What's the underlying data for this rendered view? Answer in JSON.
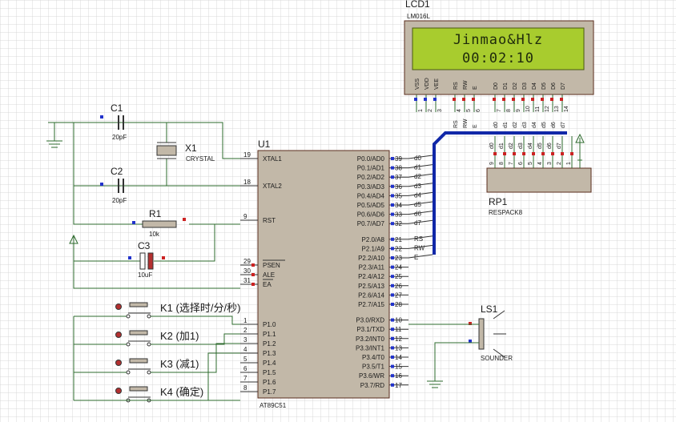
{
  "lcd": {
    "ref": "LCD1",
    "model": "LM016L",
    "line1": "Jinmao&Hlz",
    "line2": "00:02:10",
    "pins_power": [
      "VSS",
      "VDD",
      "VEE"
    ],
    "pins_ctrl": [
      "RS",
      "RW",
      "E"
    ],
    "pins_data": [
      "D0",
      "D1",
      "D2",
      "D3",
      "D4",
      "D5",
      "D6",
      "D7"
    ],
    "pin_numbers": [
      "1",
      "2",
      "3",
      "4",
      "5",
      "6",
      "7",
      "8",
      "9",
      "10",
      "11",
      "12",
      "13",
      "14"
    ],
    "bus_labels": [
      "RS",
      "RW",
      "E",
      "d0",
      "d1",
      "d2",
      "d3",
      "d4",
      "d5",
      "d6",
      "d7"
    ]
  },
  "mcu": {
    "ref": "U1",
    "part": "AT89C51",
    "left_pins": [
      {
        "num": "19",
        "name": "XTAL1"
      },
      {
        "num": "18",
        "name": "XTAL2"
      },
      {
        "num": "9",
        "name": "RST"
      },
      {
        "num": "29",
        "name": "PSEN"
      },
      {
        "num": "30",
        "name": "ALE"
      },
      {
        "num": "31",
        "name": "EA"
      },
      {
        "num": "1",
        "name": "P1.0"
      },
      {
        "num": "2",
        "name": "P1.1"
      },
      {
        "num": "3",
        "name": "P1.2"
      },
      {
        "num": "4",
        "name": "P1.3"
      },
      {
        "num": "5",
        "name": "P1.4"
      },
      {
        "num": "6",
        "name": "P1.5"
      },
      {
        "num": "7",
        "name": "P1.6"
      },
      {
        "num": "8",
        "name": "P1.7"
      }
    ],
    "right_pins": [
      {
        "num": "39",
        "name": "P0.0/AD0",
        "net": "d0"
      },
      {
        "num": "38",
        "name": "P0.1/AD1",
        "net": "d1"
      },
      {
        "num": "37",
        "name": "P0.2/AD2",
        "net": "d2"
      },
      {
        "num": "36",
        "name": "P0.3/AD3",
        "net": "d3"
      },
      {
        "num": "35",
        "name": "P0.4/AD4",
        "net": "d4"
      },
      {
        "num": "34",
        "name": "P0.5/AD5",
        "net": "d5"
      },
      {
        "num": "33",
        "name": "P0.6/AD6",
        "net": "d6"
      },
      {
        "num": "32",
        "name": "P0.7/AD7",
        "net": "d7"
      },
      {
        "num": "21",
        "name": "P2.0/A8",
        "net": "RS"
      },
      {
        "num": "22",
        "name": "P2.1/A9",
        "net": "RW"
      },
      {
        "num": "23",
        "name": "P2.2/A10",
        "net": "E"
      },
      {
        "num": "24",
        "name": "P2.3/A11",
        "net": ""
      },
      {
        "num": "25",
        "name": "P2.4/A12",
        "net": ""
      },
      {
        "num": "26",
        "name": "P2.5/A13",
        "net": ""
      },
      {
        "num": "27",
        "name": "P2.6/A14",
        "net": ""
      },
      {
        "num": "28",
        "name": "P2.7/A15",
        "net": ""
      },
      {
        "num": "10",
        "name": "P3.0/RXD",
        "net": ""
      },
      {
        "num": "11",
        "name": "P3.1/TXD",
        "net": ""
      },
      {
        "num": "12",
        "name": "P3.2/INT0",
        "net": ""
      },
      {
        "num": "13",
        "name": "P3.3/INT1",
        "net": ""
      },
      {
        "num": "14",
        "name": "P3.4/T0",
        "net": ""
      },
      {
        "num": "15",
        "name": "P3.5/T1",
        "net": ""
      },
      {
        "num": "16",
        "name": "P3.6/WR",
        "net": ""
      },
      {
        "num": "17",
        "name": "P3.7/RD",
        "net": ""
      }
    ]
  },
  "components": {
    "c1": {
      "ref": "C1",
      "value": "20pF"
    },
    "c2": {
      "ref": "C2",
      "value": "20pF"
    },
    "x1": {
      "ref": "X1",
      "value": "CRYSTAL"
    },
    "r1": {
      "ref": "R1",
      "value": "10k"
    },
    "c3": {
      "ref": "C3",
      "value": "10uF"
    },
    "rp1": {
      "ref": "RP1",
      "value": "RESPACK8",
      "pins": [
        "9",
        "8",
        "7",
        "6",
        "5",
        "4",
        "3",
        "2",
        "1"
      ]
    },
    "ls1": {
      "ref": "LS1",
      "value": "SOUNDER"
    }
  },
  "keys": [
    {
      "ref": "K1",
      "label": "K1 (选择时/分/秒)"
    },
    {
      "ref": "K2",
      "label": "K2 (加1)"
    },
    {
      "ref": "K3",
      "label": "K3 (减1)"
    },
    {
      "ref": "K4",
      "label": "K4 (确定)"
    }
  ],
  "colors": {
    "grid": "#d8d8d8",
    "wire": "#2e6b2e",
    "chip_fill": "#c2b8a8",
    "chip_border": "#5a2d1d",
    "lcd_screen": "#a8cc2e",
    "lcd_text": "#1e2a0c",
    "bus": "#1128a8",
    "pin_red": "#cc2222",
    "pin_blue": "#2233cc",
    "component": "#b43030"
  }
}
